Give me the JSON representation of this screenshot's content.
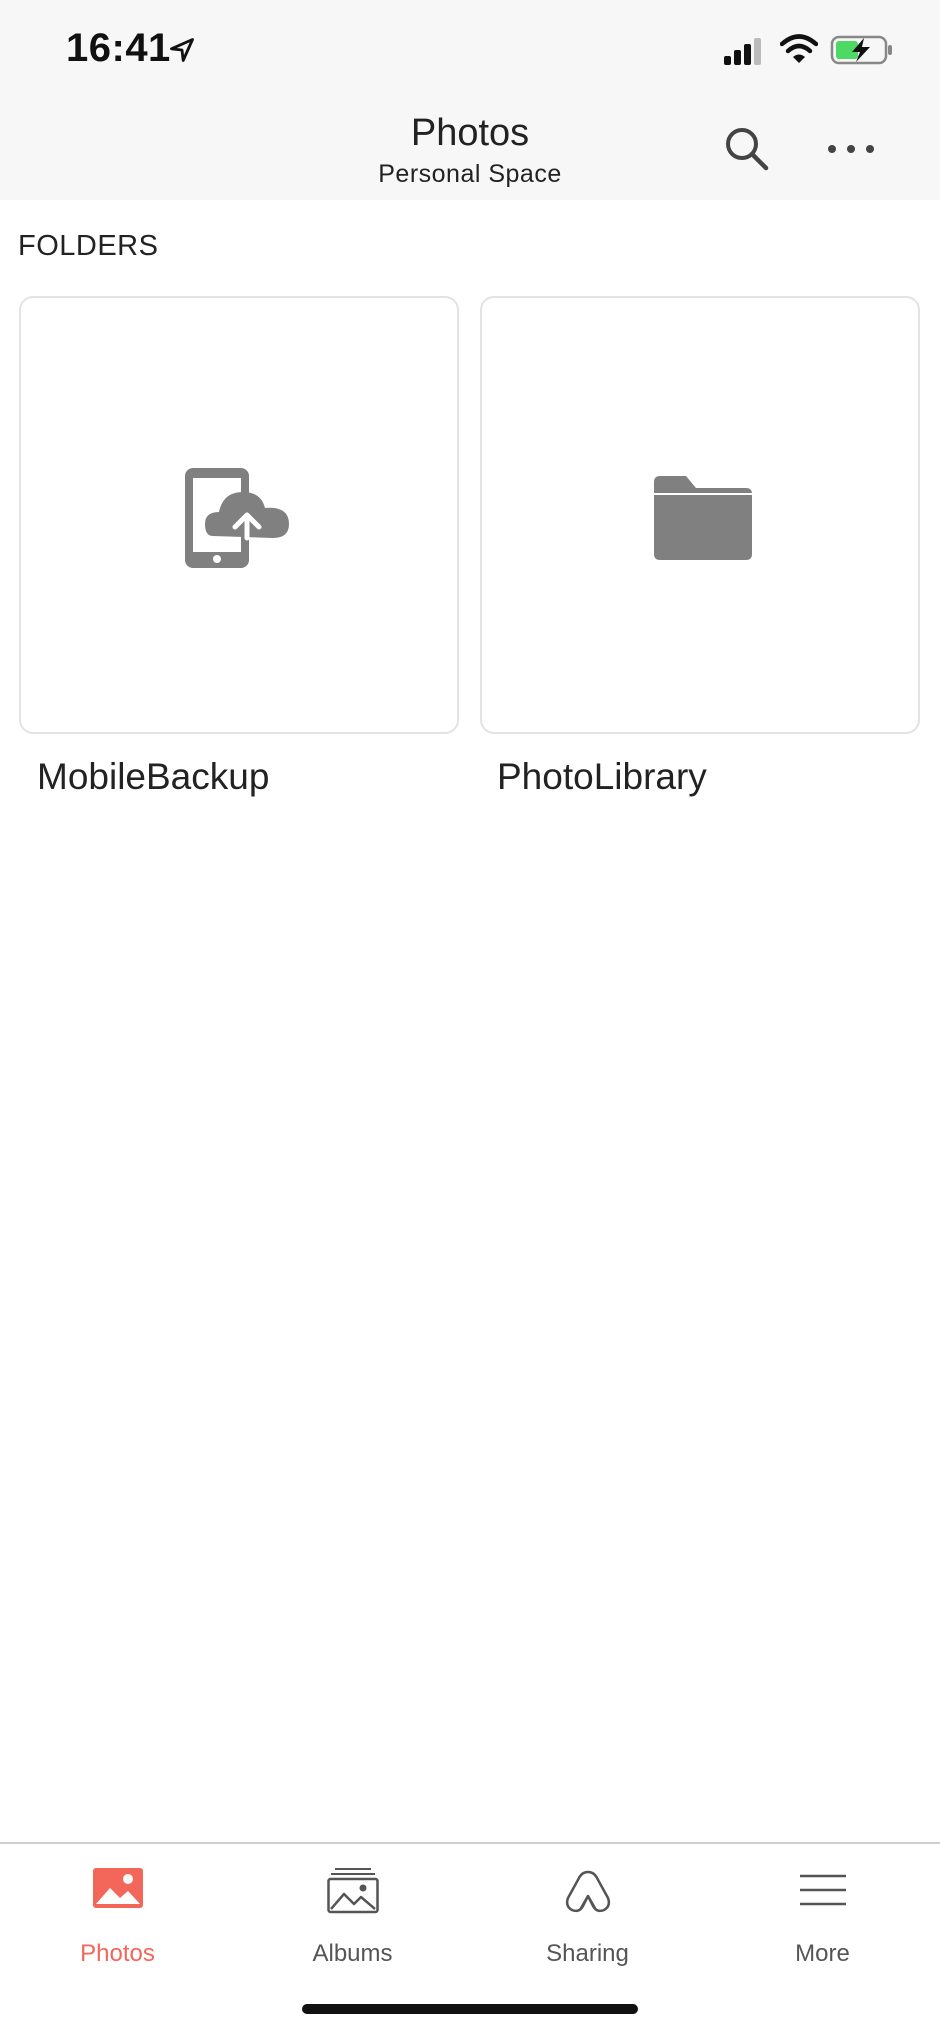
{
  "status_bar": {
    "time": "16:41"
  },
  "header": {
    "title": "Photos",
    "subtitle": "Personal Space"
  },
  "section": {
    "label": "FOLDERS"
  },
  "folders": [
    {
      "name": "MobileBackup",
      "icon": "phone-cloud-upload-icon"
    },
    {
      "name": "PhotoLibrary",
      "icon": "folder-icon"
    }
  ],
  "tabs": [
    {
      "label": "Photos",
      "icon": "photos-icon",
      "active": true
    },
    {
      "label": "Albums",
      "icon": "albums-icon",
      "active": false
    },
    {
      "label": "Sharing",
      "icon": "sharing-icon",
      "active": false
    },
    {
      "label": "More",
      "icon": "menu-icon",
      "active": false
    }
  ],
  "colors": {
    "accent": "#f2675a",
    "icon_gray": "#808080",
    "battery_green": "#4cd964"
  }
}
